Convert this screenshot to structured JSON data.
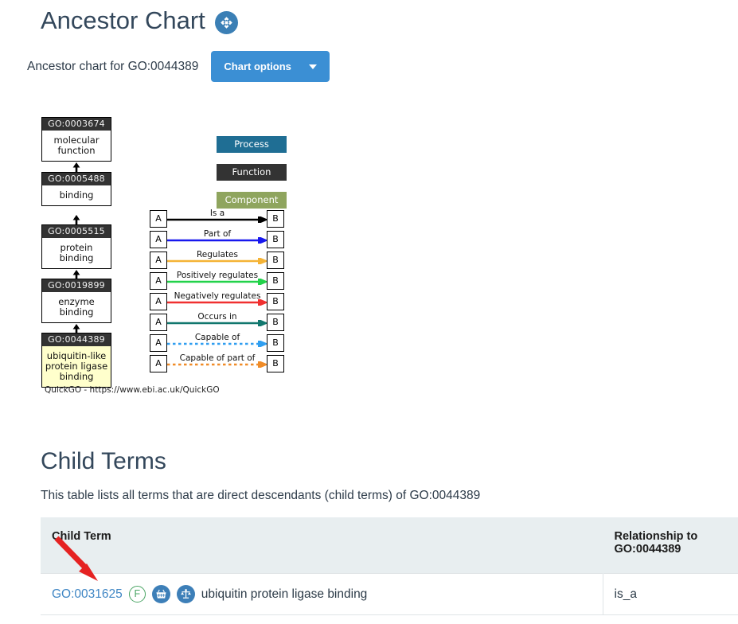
{
  "header": {
    "title": "Ancestor Chart",
    "expand_icon": "expand-arrows-icon",
    "subtitle": "Ancestor chart for GO:0044389",
    "chart_options_label": "Chart options"
  },
  "chart": {
    "credit": "QuickGO - https://www.ebi.ac.uk/QuickGO",
    "focus_term": "GO:0044389",
    "nodes": [
      {
        "id": "GO:0003674",
        "label": "molecular function",
        "focus": false
      },
      {
        "id": "GO:0005488",
        "label": "binding",
        "focus": false
      },
      {
        "id": "GO:0005515",
        "label": "protein binding",
        "focus": false
      },
      {
        "id": "GO:0019899",
        "label": "enzyme binding",
        "focus": false
      },
      {
        "id": "GO:0044389",
        "label": "ubiquitin-like protein ligase binding",
        "focus": true
      }
    ],
    "aspect_legend": [
      {
        "label": "Process",
        "color": "#1f6e94"
      },
      {
        "label": "Function",
        "color": "#333333"
      },
      {
        "label": "Component",
        "color": "#8fa55e"
      }
    ],
    "relation_legend": [
      {
        "label": "Is a",
        "color": "#000000",
        "style": "solid",
        "from": "A",
        "to": "B"
      },
      {
        "label": "Part of",
        "color": "#1818ee",
        "style": "solid",
        "from": "A",
        "to": "B"
      },
      {
        "label": "Regulates",
        "color": "#f5b335",
        "style": "solid",
        "from": "A",
        "to": "B"
      },
      {
        "label": "Positively regulates",
        "color": "#22d24a",
        "style": "solid",
        "from": "A",
        "to": "B"
      },
      {
        "label": "Negatively regulates",
        "color": "#f03030",
        "style": "solid",
        "from": "A",
        "to": "B"
      },
      {
        "label": "Occurs in",
        "color": "#11776e",
        "style": "solid",
        "from": "A",
        "to": "B"
      },
      {
        "label": "Capable of",
        "color": "#2f9ef0",
        "style": "dotted",
        "from": "A",
        "to": "B"
      },
      {
        "label": "Capable of part of",
        "color": "#f08c28",
        "style": "dotted",
        "from": "A",
        "to": "B"
      }
    ]
  },
  "child_terms": {
    "heading": "Child Terms",
    "description": "This table lists all terms that are direct descendants (child terms) of GO:0044389",
    "columns": {
      "term": "Child Term",
      "relationship": "Relationship to GO:0044389"
    },
    "rows": [
      {
        "go_id": "GO:0031625",
        "aspect_badge": "F",
        "icons": [
          "basket-icon",
          "balance-scale-icon"
        ],
        "name": "ubiquitin protein ligase binding",
        "relationship": "is_a"
      }
    ]
  }
}
